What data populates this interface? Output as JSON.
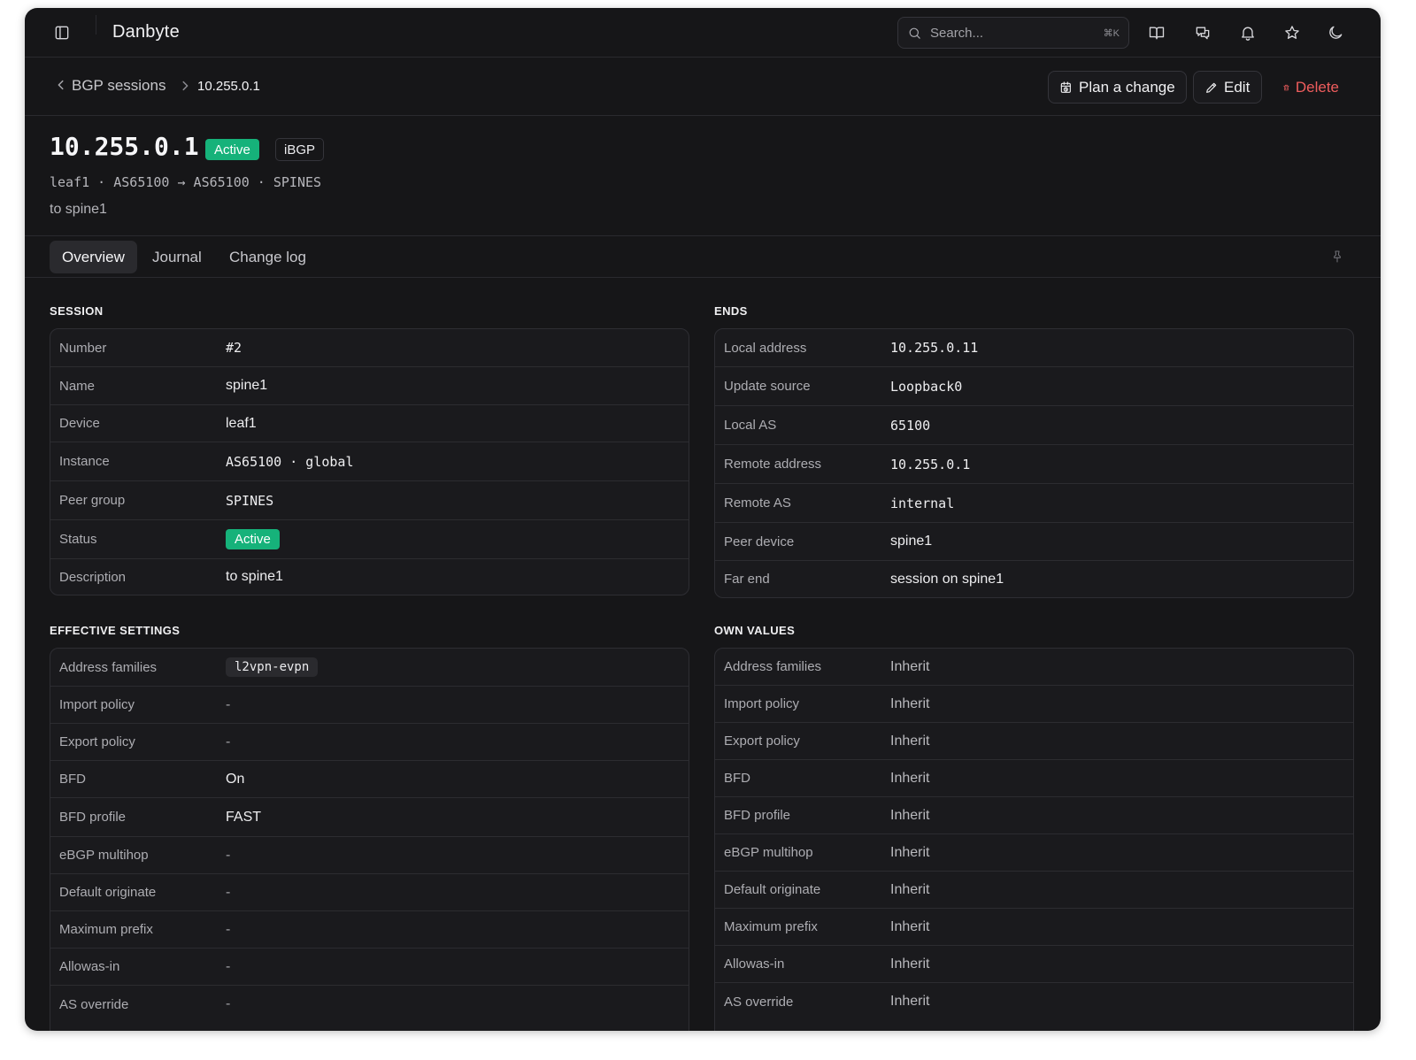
{
  "app": {
    "title": "Danbyte"
  },
  "search": {
    "placeholder": "Search...",
    "shortcut": "⌘K"
  },
  "breadcrumb": {
    "parent": "BGP sessions",
    "current": "10.255.0.1"
  },
  "actions": {
    "plan_label": "Plan a change",
    "edit_label": "Edit",
    "delete_label": "Delete"
  },
  "header": {
    "title": "10.255.0.1",
    "status_badge": "Active",
    "type_badge": "iBGP",
    "subtitle": "leaf1 · AS65100 → AS65100 · SPINES",
    "description": "to spine1"
  },
  "tabs": [
    {
      "label": "Overview"
    },
    {
      "label": "Journal"
    },
    {
      "label": "Change log"
    }
  ],
  "session": {
    "title": "SESSION",
    "rows": [
      {
        "label": "Number",
        "value": "#2"
      },
      {
        "label": "Name",
        "value": "spine1"
      },
      {
        "label": "Device",
        "value": "leaf1"
      },
      {
        "label": "Instance",
        "value": "AS65100 · global"
      },
      {
        "label": "Peer group",
        "value": "SPINES"
      },
      {
        "label": "Status",
        "value": "Active"
      },
      {
        "label": "Description",
        "value": "to spine1"
      }
    ]
  },
  "ends": {
    "title": "ENDS",
    "rows": [
      {
        "label": "Local address",
        "value": "10.255.0.11"
      },
      {
        "label": "Update source",
        "value": "Loopback0"
      },
      {
        "label": "Local AS",
        "value": "65100"
      },
      {
        "label": "Remote address",
        "value": "10.255.0.1"
      },
      {
        "label": "Remote AS",
        "value": "internal"
      },
      {
        "label": "Peer device",
        "value": "spine1"
      },
      {
        "label": "Far end",
        "value": "session on spine1"
      }
    ]
  },
  "effective": {
    "title": "EFFECTIVE SETTINGS",
    "rows": [
      {
        "label": "Address families",
        "value": "l2vpn-evpn"
      },
      {
        "label": "Import policy",
        "value": "-"
      },
      {
        "label": "Export policy",
        "value": "-"
      },
      {
        "label": "BFD",
        "value": "On"
      },
      {
        "label": "BFD profile",
        "value": "FAST"
      },
      {
        "label": "eBGP multihop",
        "value": "-"
      },
      {
        "label": "Default originate",
        "value": "-"
      },
      {
        "label": "Maximum prefix",
        "value": "-"
      },
      {
        "label": "Allowas-in",
        "value": "-"
      },
      {
        "label": "AS override",
        "value": "-"
      }
    ]
  },
  "own": {
    "title": "OWN VALUES",
    "rows": [
      {
        "label": "Address families",
        "value": "Inherit"
      },
      {
        "label": "Import policy",
        "value": "Inherit"
      },
      {
        "label": "Export policy",
        "value": "Inherit"
      },
      {
        "label": "BFD",
        "value": "Inherit"
      },
      {
        "label": "BFD profile",
        "value": "Inherit"
      },
      {
        "label": "eBGP multihop",
        "value": "Inherit"
      },
      {
        "label": "Default originate",
        "value": "Inherit"
      },
      {
        "label": "Maximum prefix",
        "value": "Inherit"
      },
      {
        "label": "Allowas-in",
        "value": "Inherit"
      },
      {
        "label": "AS override",
        "value": "Inherit"
      }
    ]
  },
  "colors": {
    "accent_green": "#16b27a",
    "danger": "#ef5d5d",
    "background": "#161618"
  }
}
